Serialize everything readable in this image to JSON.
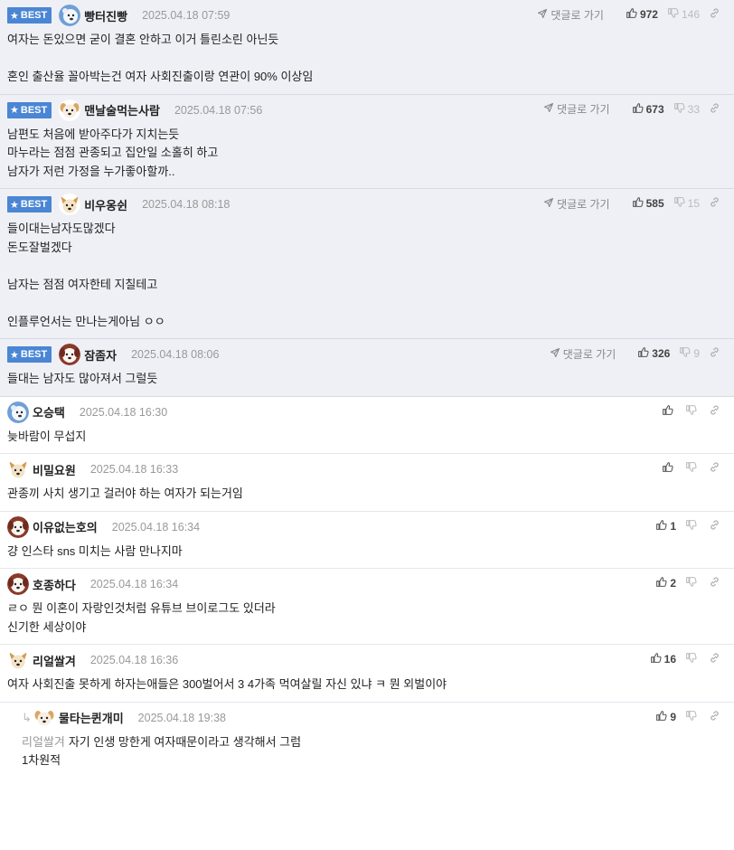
{
  "ui": {
    "best_label": "BEST",
    "goto_label": "댓글로 가기"
  },
  "comments": [
    {
      "best": true,
      "avatar": "polar-bear",
      "nick": "빵터진빵",
      "date": "2025.04.18 07:59",
      "likes": "972",
      "dislikes": "146",
      "lines": [
        "여자는 돈있으면 굳이 결혼 안하고 이거 틀린소린 아닌듯",
        "",
        "혼인 출산율 꼴아박는건 여자 사회진출이랑 연관이 90% 이상임"
      ]
    },
    {
      "best": true,
      "avatar": "dog-white",
      "nick": "맨날술먹는사람",
      "date": "2025.04.18 07:56",
      "likes": "673",
      "dislikes": "33",
      "lines": [
        "남편도 처음에 받아주다가 지치는듯",
        "마누라는 점점 관종되고 집안일 소홀히 하고",
        "남자가 저런 가정을 누가좋아할까.."
      ]
    },
    {
      "best": true,
      "avatar": "fox-dog",
      "nick": "비우옹쉰",
      "date": "2025.04.18 08:18",
      "likes": "585",
      "dislikes": "15",
      "lines": [
        "들이대는남자도많겠다",
        "돈도잘벌겠다",
        "",
        "남자는 점점 여자한테 지칠테고",
        "",
        "인플루언서는 만나는게아님 ㅇㅇ"
      ]
    },
    {
      "best": true,
      "avatar": "dog-red",
      "nick": "잠좀자",
      "date": "2025.04.18 08:06",
      "likes": "326",
      "dislikes": "9",
      "lines": [
        "들대는 남자도 많아져서 그럴듯"
      ]
    },
    {
      "best": false,
      "avatar": "polar-bear",
      "nick": "오승택",
      "date": "2025.04.18 16:30",
      "likes": "",
      "dislikes": "",
      "lines": [
        "늦바람이 무섭지"
      ]
    },
    {
      "best": false,
      "avatar": "fox-dog",
      "nick": "비밀요원",
      "date": "2025.04.18 16:33",
      "likes": "",
      "dislikes": "",
      "lines": [
        "관종끼 사치 생기고 걸러야 하는 여자가 되는거임"
      ]
    },
    {
      "best": false,
      "avatar": "dog-red",
      "nick": "이유없는호의",
      "date": "2025.04.18 16:34",
      "likes": "1",
      "dislikes": "",
      "lines": [
        "걍 인스타 sns 미치는 사람 만나지마"
      ]
    },
    {
      "best": false,
      "avatar": "dog-red",
      "nick": "호종하다",
      "date": "2025.04.18 16:34",
      "likes": "2",
      "dislikes": "",
      "lines": [
        "ㄹㅇ 뭔 이혼이 자랑인것처럼 유튜브 브이로그도 있더라",
        "신기한 세상이야"
      ]
    },
    {
      "best": false,
      "avatar": "fox-dog",
      "nick": "리얼쌀겨",
      "date": "2025.04.18 16:36",
      "likes": "16",
      "dislikes": "",
      "lines": [
        "여자 사회진출 못하게 하자는애들은 300벌어서 3 4가족 먹여살릴 자신 있냐 ㅋ 뭔 외벌이야"
      ]
    },
    {
      "best": false,
      "reply": true,
      "avatar": "dog-white",
      "nick": "물타는퀸개미",
      "date": "2025.04.18 19:38",
      "likes": "9",
      "dislikes": "",
      "mention": "리얼쌀겨",
      "lines": [
        "자기 인생 망한게 여자때문이라고 생각해서 그럼",
        "1차원적"
      ]
    }
  ]
}
